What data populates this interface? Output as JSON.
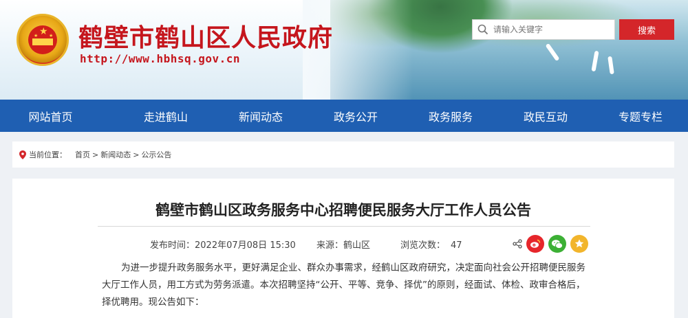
{
  "header": {
    "site_title": "鹤壁市鹤山区人民政府",
    "site_url": "http://www.hbhsq.gov.cn",
    "emblem_icon": "national-emblem-icon",
    "search_placeholder": "请输入关键字",
    "search_button": "搜索",
    "colors": {
      "title_red": "#c5161d",
      "search_button": "#d4262a"
    }
  },
  "nav": {
    "items": [
      {
        "label": "网站首页"
      },
      {
        "label": "走进鹤山"
      },
      {
        "label": "新闻动态"
      },
      {
        "label": "政务公开"
      },
      {
        "label": "政务服务"
      },
      {
        "label": "政民互动"
      },
      {
        "label": "专题专栏"
      }
    ],
    "background": "#1f5fb2"
  },
  "breadcrumb": {
    "prefix": "当前位置：",
    "items": [
      "首页",
      "新闻动态",
      "公示公告"
    ],
    "separator": ">"
  },
  "article": {
    "title": "鹤壁市鹤山区政务服务中心招聘便民服务大厅工作人员公告",
    "publish_time_label": "发布时间：",
    "publish_time": "2022年07月08日 15:30",
    "source_label": "来源：",
    "source": "鹤山区",
    "views_label": "浏览次数：",
    "views": "47",
    "share_icons": [
      "share-icon",
      "weibo-icon",
      "wechat-icon",
      "favorite-icon"
    ],
    "body": "为进一步提升政务服务水平，更好满足企业、群众办事需求，经鹤山区政府研究，决定面向社会公开招聘便民服务大厅工作人员，用工方式为劳务派遣。本次招聘坚持“公开、平等、竞争、择优”的原则，经面试、体检、政审合格后，择优聘用。现公告如下："
  }
}
